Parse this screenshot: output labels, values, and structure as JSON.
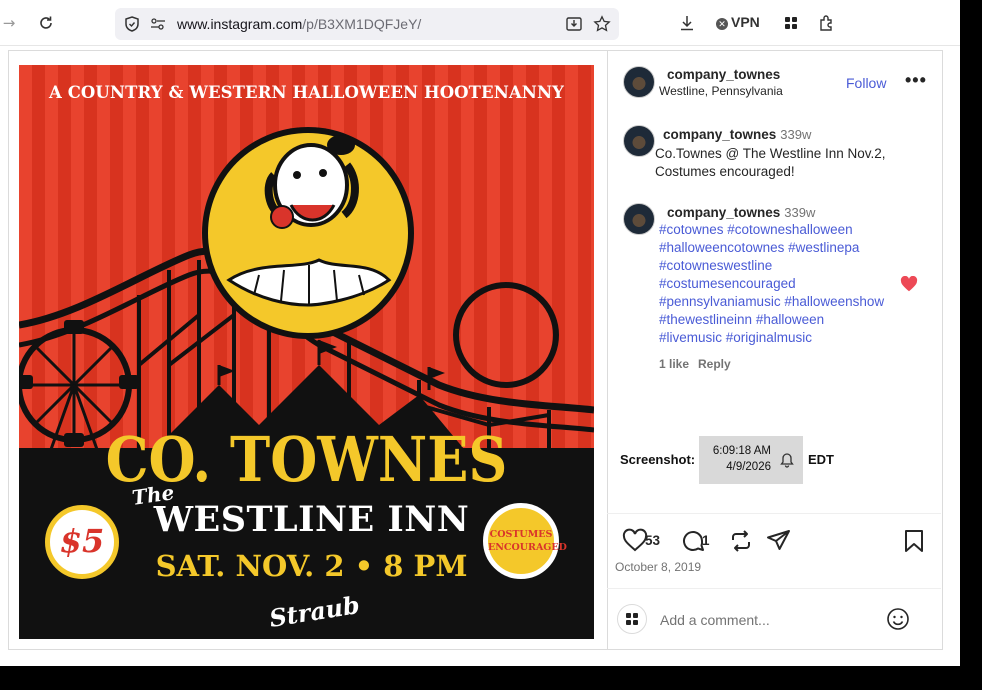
{
  "browser": {
    "url_host": "www.instagram.com",
    "url_path": "/p/B3XM1DQFJeY/",
    "vpn_label": "VPN"
  },
  "poster": {
    "tagline": "A COUNTRY & WESTERN HALLOWEEN HOOTENANNY",
    "band": "CO. TOWNES",
    "the": "The",
    "venue": "WESTLINE INN",
    "date_time": "SAT. NOV. 2 • 8 PM",
    "sponsor": "Straub",
    "price": "$5",
    "badge_line1": "COSTUMES",
    "badge_line2": "ENCOURAGED"
  },
  "post": {
    "username": "company_townes",
    "location": "Westline, Pennsylvania",
    "follow_label": "Follow",
    "more_label": "•••",
    "caption_time": "339w",
    "caption": "Co.Townes @ The Westline Inn Nov.2, Costumes encouraged!",
    "comment_time": "339w",
    "hashtags": [
      "#cotownes #cotowneshalloween",
      "#halloweencotownes #westlinepa",
      "#cotowneswestline",
      "#costumesencouraged",
      "#pennsylvaniamusic #halloweenshow",
      "#thewestlineinn #halloween",
      "#livemusic #originalmusic"
    ],
    "comment_likes": "1 like",
    "reply_label": "Reply",
    "like_count": "53",
    "comment_count": "1",
    "post_date": "October 8, 2019",
    "add_comment_placeholder": "Add a comment..."
  },
  "screenshot_overlay": {
    "label": "Screenshot:",
    "time": "6:09:18 AM",
    "date": "4/9/2026",
    "timezone": "EDT"
  },
  "colors": {
    "poster_red": "#e8432e",
    "poster_yellow": "#f4c82a",
    "link_blue": "#4a5bd6",
    "heart_red": "#ed4956"
  }
}
